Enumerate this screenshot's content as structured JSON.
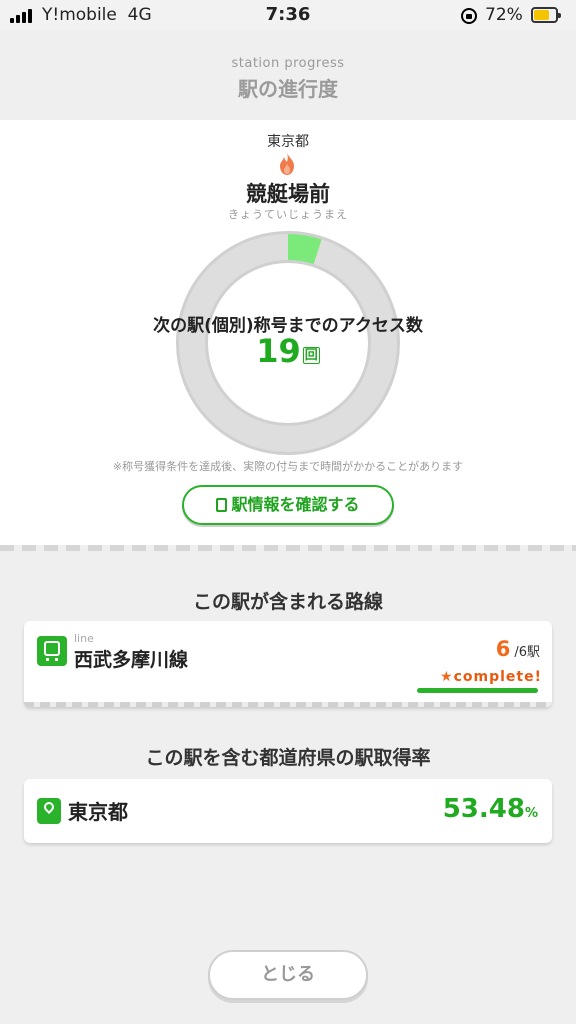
{
  "status_bar": {
    "carrier": "Y!mobile",
    "network": "4G",
    "time": "7:36",
    "battery_percent": "72%"
  },
  "header": {
    "subtitle": "station progress",
    "title": "駅の進行度"
  },
  "station": {
    "prefecture": "東京都",
    "name": "競艇場前",
    "kana": "きょうていじょうまえ",
    "progress_label": "次の駅(個別)称号までのアクセス数",
    "remaining_count": "19",
    "remaining_unit": "回",
    "progress_fraction": 0.05,
    "progress_color": "#7bea7b",
    "note": "※称号獲得条件を達成後、実際の付与まで時間がかかることがあります",
    "info_button_label": "駅情報を確認する"
  },
  "lines_section": {
    "title": "この駅が含まれる路線",
    "lines": [
      {
        "sub_label": "line",
        "name": "西武多摩川線",
        "acquired": "6",
        "total": "/6駅",
        "badge": "complete!"
      }
    ]
  },
  "prefecture_section": {
    "title": "この駅を含む都道府県の駅取得率",
    "name": "東京都",
    "rate": "53.48",
    "rate_unit": "%"
  },
  "close_button_label": "とじる",
  "colors": {
    "accent_green": "#2ab32a",
    "orange": "#f26b1d"
  }
}
